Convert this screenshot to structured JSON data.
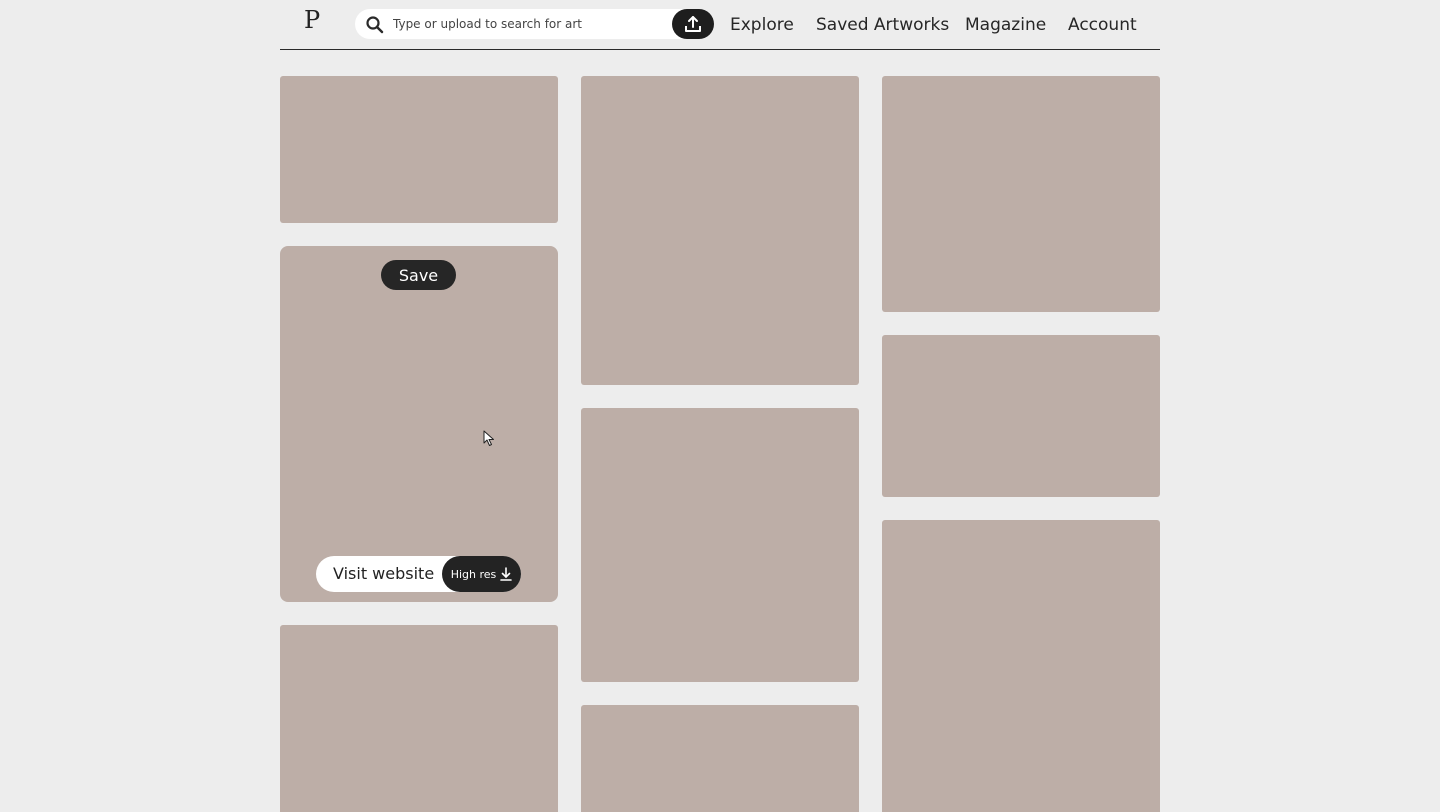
{
  "header": {
    "logo": "P",
    "search": {
      "placeholder": "Type or upload to search for art",
      "value": ""
    },
    "upload_icon": "upload-icon",
    "nav": [
      "Explore",
      "Saved Artworks",
      "Magazine",
      "Account"
    ]
  },
  "grid": {
    "tile_color": "#bdaea7",
    "hovered_tile": {
      "save_label": "Save",
      "visit_label": "Visit website",
      "hires_label": "High res",
      "download_icon": "download-icon"
    }
  },
  "colors": {
    "background": "#ededed",
    "dark": "#1e1e1e",
    "white": "#ffffff"
  }
}
